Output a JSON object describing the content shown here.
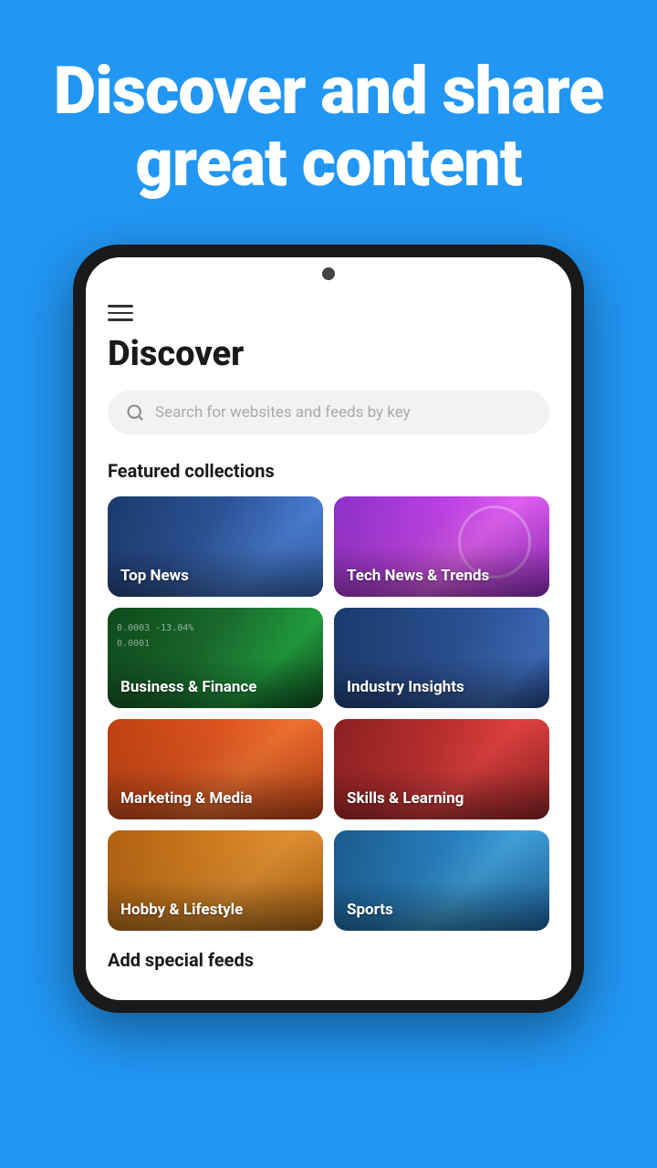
{
  "hero": {
    "title": "Discover and share great content"
  },
  "app": {
    "page_title": "Discover",
    "search_placeholder": "Search for websites and feeds by key",
    "featured_section_title": "Featured collections",
    "add_feeds_title": "Add special feeds",
    "menu_icon_label": "Menu"
  },
  "collections": [
    {
      "id": "top-news",
      "label": "Top News",
      "card_class": "card-top-news"
    },
    {
      "id": "tech-news",
      "label": "Tech News & Trends",
      "card_class": "card-tech-news"
    },
    {
      "id": "business",
      "label": "Business & Finance",
      "card_class": "card-business"
    },
    {
      "id": "industry",
      "label": "Industry Insights",
      "card_class": "card-industry"
    },
    {
      "id": "marketing",
      "label": "Marketing & Media",
      "card_class": "card-marketing"
    },
    {
      "id": "skills",
      "label": "Skills & Learning",
      "card_class": "card-skills"
    },
    {
      "id": "hobby",
      "label": "Hobby & Lifestyle",
      "card_class": "card-hobby"
    },
    {
      "id": "sports",
      "label": "Sports",
      "card_class": "card-sports"
    }
  ]
}
